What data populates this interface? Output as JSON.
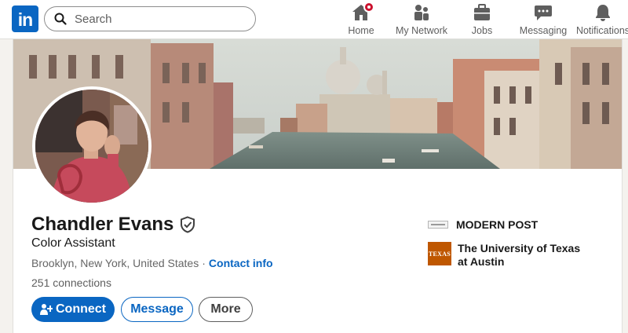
{
  "nav": {
    "logo": "in",
    "search_placeholder": "Search",
    "items": [
      {
        "label": "Home",
        "icon": "home-icon",
        "badge": true
      },
      {
        "label": "My Network",
        "icon": "network-icon"
      },
      {
        "label": "Jobs",
        "icon": "briefcase-icon"
      },
      {
        "label": "Messaging",
        "icon": "messaging-icon"
      },
      {
        "label": "Notifications",
        "icon": "bell-icon"
      }
    ]
  },
  "profile": {
    "name": "Chandler Evans",
    "headline": "Color Assistant",
    "location": "Brooklyn, New York, United States",
    "separator": "·",
    "contact_label": "Contact info",
    "connections": "251 connections"
  },
  "actions": {
    "connect": "Connect",
    "message": "Message",
    "more": "More"
  },
  "sidebar": {
    "company": "MODERN POST",
    "education": "The University of Texas at Austin",
    "education_logo_text": "TEXAS"
  },
  "colors": {
    "brand": "#0a66c2",
    "badge": "#cb112d",
    "ut_orange": "#bf5700"
  }
}
